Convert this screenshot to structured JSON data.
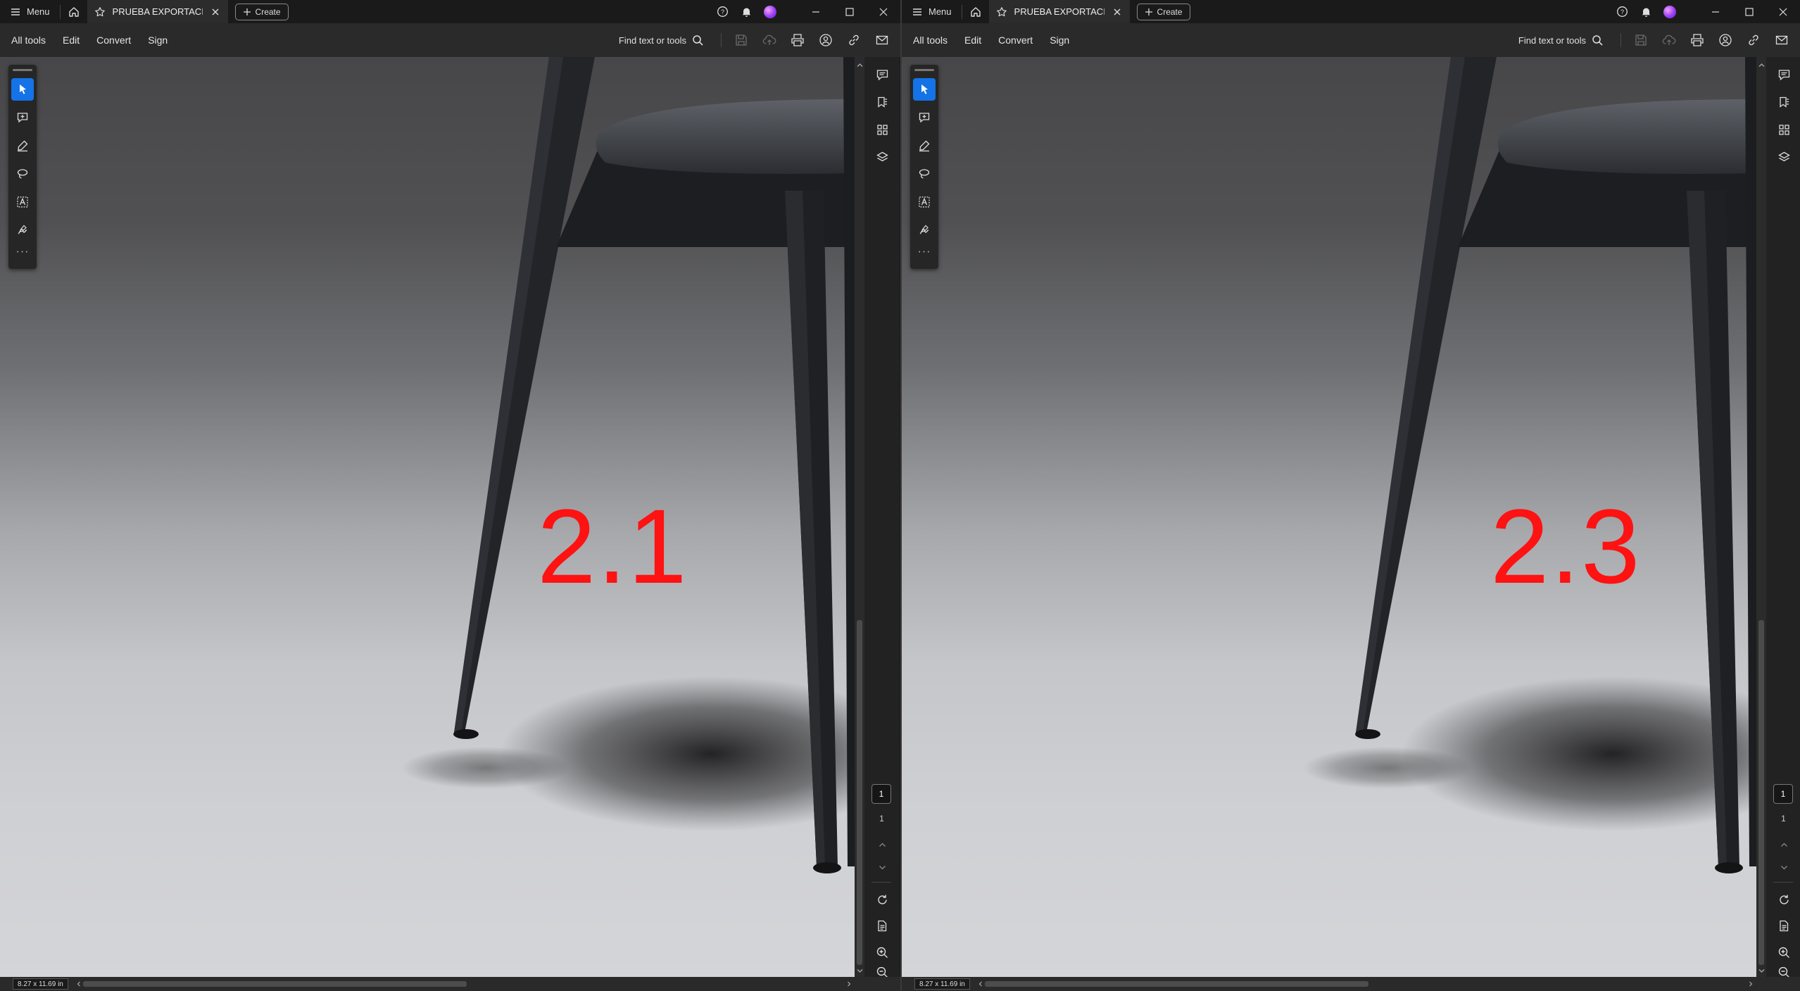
{
  "windows": [
    {
      "id": "left",
      "menu_label": "Menu",
      "tab_title": "PRUEBA EXPORTACION...",
      "create_label": "Create",
      "toolbar_menus": [
        "All tools",
        "Edit",
        "Convert",
        "Sign"
      ],
      "find_label": "Find text or tools",
      "document_number": "2.1",
      "current_page": "1",
      "total_pages": "1",
      "page_size": "8.27 x 11.69 in"
    },
    {
      "id": "right",
      "menu_label": "Menu",
      "tab_title": "PRUEBA EXPORTACION...",
      "create_label": "Create",
      "toolbar_menus": [
        "All tools",
        "Edit",
        "Convert",
        "Sign"
      ],
      "find_label": "Find text or tools",
      "document_number": "2.3",
      "current_page": "1",
      "total_pages": "1",
      "page_size": "8.27 x 11.69 in"
    }
  ],
  "colors": {
    "accent": "#1473e6",
    "document_number": "#ff1212",
    "title_bar": "#1a1a1a",
    "toolbar": "#2a2a2a"
  },
  "icons": {
    "title_bar": [
      "hamburger-icon",
      "home-icon",
      "star-icon",
      "close-icon",
      "plus-icon",
      "help-icon",
      "bell-icon",
      "avatar",
      "minimize-icon",
      "maximize-icon",
      "window-close-icon"
    ],
    "actions": [
      "save-icon",
      "upload-cloud-icon",
      "print-icon",
      "share-user-icon",
      "link-icon",
      "email-icon"
    ],
    "rail": [
      "select-cursor-icon",
      "add-comment-icon",
      "highlight-pen-icon",
      "lasso-draw-icon",
      "text-box-icon",
      "fill-sign-icon",
      "more-icon"
    ],
    "right_panel": [
      "comments-icon",
      "bookmark-icon",
      "thumbnails-icon",
      "layers-icon",
      "refresh-icon",
      "page-settings-icon",
      "zoom-in-icon",
      "zoom-out-icon"
    ]
  }
}
